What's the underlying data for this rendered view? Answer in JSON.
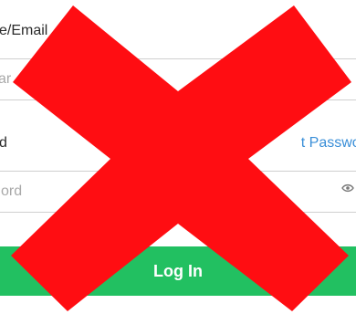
{
  "form": {
    "username_label": "e/Email",
    "username_placeholder": "ar",
    "password_label": "d",
    "forgot_link": "t Passwor",
    "password_placeholder": "ord",
    "login_button": "Log In"
  },
  "colors": {
    "accent_green": "#22c061",
    "link_blue": "#3a8fd8",
    "overlay_red": "#ff0d12"
  },
  "icons": {
    "password_toggle": "eye-icon",
    "overlay": "cross-mark-icon"
  }
}
